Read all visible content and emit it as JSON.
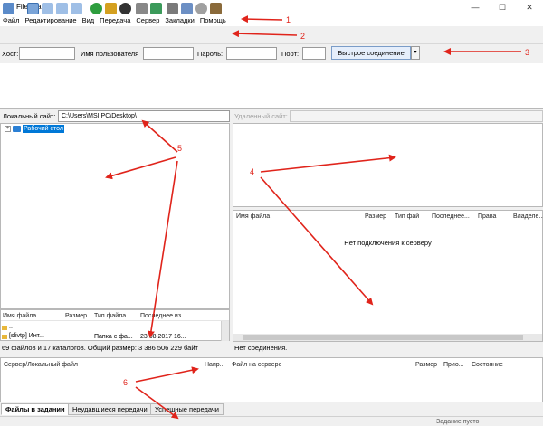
{
  "window": {
    "icon_letter": "Z",
    "title": "FileZilla",
    "minimize": "—",
    "maximize": "☐",
    "close": "✕"
  },
  "menu": [
    "Файл",
    "Редактирование",
    "Вид",
    "Передача",
    "Сервер",
    "Закладки",
    "Помощь"
  ],
  "quickconnect": {
    "host_label": "Хост:",
    "user_label": "Имя пользователя",
    "pass_label": "Пароль:",
    "port_label": "Порт:",
    "button_label": "Быстрое соединение",
    "dropdown": "▾"
  },
  "local": {
    "label": "Локальный сайт:",
    "path": "C:\\Users\\MSI PC\\Desktop\\",
    "tree_expand": "+",
    "tree_item": "Рабочий стол",
    "columns": [
      "Имя файла",
      "Размер",
      "Тип файла",
      "Последнее из..."
    ],
    "rows": [
      {
        "name": "..",
        "size": "",
        "type": "",
        "modified": ""
      },
      {
        "name": "[slivtp] Инт...",
        "size": "",
        "type": "Папка с фа...",
        "modified": "23.08.2017 16..."
      }
    ],
    "status": "69 файлов и 17 каталогов. Общий размер: 3 386 506 229 байт"
  },
  "remote": {
    "label": "Удаленный сайт:",
    "columns": [
      "Имя файла",
      "Размер",
      "Тип фай",
      "Последнее...",
      "Права",
      "Владеле..."
    ],
    "empty": "Нет подключения к серверу",
    "status": "Нет соединения."
  },
  "queue": {
    "columns": [
      "Сервер/Локальный файл",
      "Напр...",
      "Файл на сервере",
      "Размер",
      "Прио...",
      "Состояние"
    ]
  },
  "tabs": [
    "Файлы в задании",
    "Неудавшиеся передачи",
    "Успешные передачи"
  ],
  "statusbar": {
    "queue": "Задание пусто"
  },
  "annotations": [
    "1",
    "2",
    "3",
    "4",
    "5",
    "6"
  ],
  "colors": {
    "arrow": "#e0241b",
    "selection": "#0078d7",
    "brand": "#c0392b"
  }
}
